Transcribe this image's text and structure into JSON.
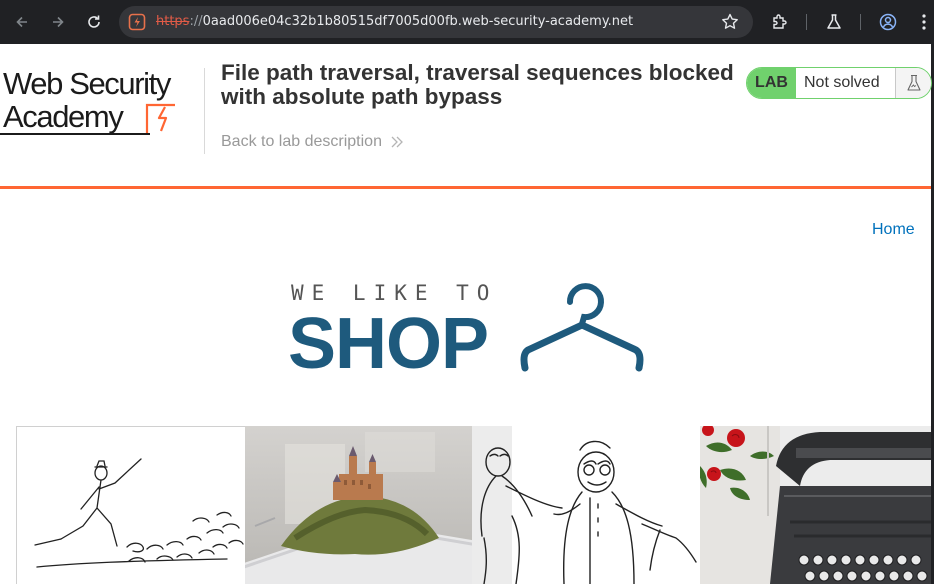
{
  "browser": {
    "url_scheme": "https",
    "url_separator": "://",
    "url_host": "0aad006e04c32b1b80515df7005d00fb.web-security-academy.net",
    "icons": [
      "back-icon",
      "forward-icon",
      "reload-icon",
      "site-info-icon",
      "bookmark-star-icon",
      "extensions-icon",
      "labs-flask-icon",
      "profile-icon",
      "more-menu-icon"
    ]
  },
  "header": {
    "logo_line1": "Web Security",
    "logo_line2": "Academy",
    "lab_title": "File path traversal, traversal sequences blocked with absolute path bypass",
    "back_link": "Back to lab description",
    "status_tag": "LAB",
    "status_text": "Not solved"
  },
  "shop": {
    "home_link": "Home",
    "tagline": "WE LIKE TO",
    "brand_word": "SHOP"
  },
  "products": [
    {
      "image": "sketch-man-running-with-cats"
    },
    {
      "image": "castle-rising-from-smartphone"
    },
    {
      "image": "sketch-two-men-dancing"
    },
    {
      "image": "typewriter-with-red-roses"
    }
  ],
  "colors": {
    "chrome_bg": "#202124",
    "omnibox_bg": "#35363a",
    "accent_orange": "#ff6633",
    "lab_green": "#70d16d",
    "link_blue": "#0071bc",
    "shop_blue": "#1e5a7d"
  }
}
